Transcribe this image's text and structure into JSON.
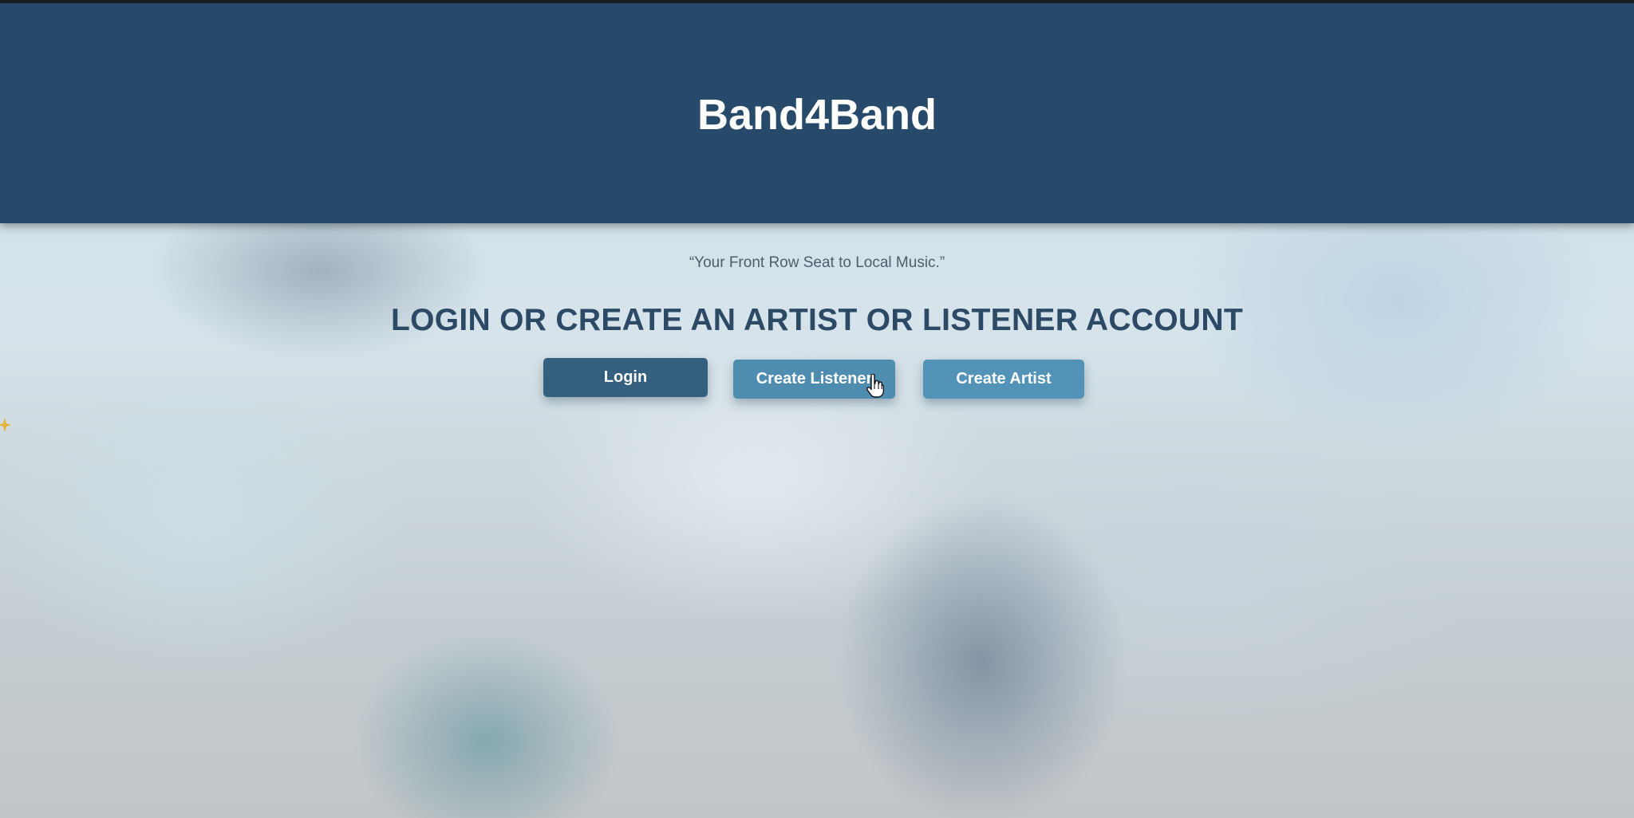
{
  "header": {
    "brand": "Band4Band"
  },
  "main": {
    "tagline": "“Your Front Row Seat to Local Music.”",
    "heading": "LOGIN OR CREATE AN ARTIST OR LISTENER ACCOUNT",
    "buttons": {
      "login": "Login",
      "create_listener": "Create Listener",
      "create_artist": "Create Artist"
    }
  },
  "icons": {
    "cursor": "hand-pointer-icon",
    "sparkle": "sparkle-icon"
  },
  "colors": {
    "header_bg": "#274a6b",
    "heading": "#2c4a66",
    "login_button": "#345f7e",
    "create_button": "#5393b7"
  }
}
